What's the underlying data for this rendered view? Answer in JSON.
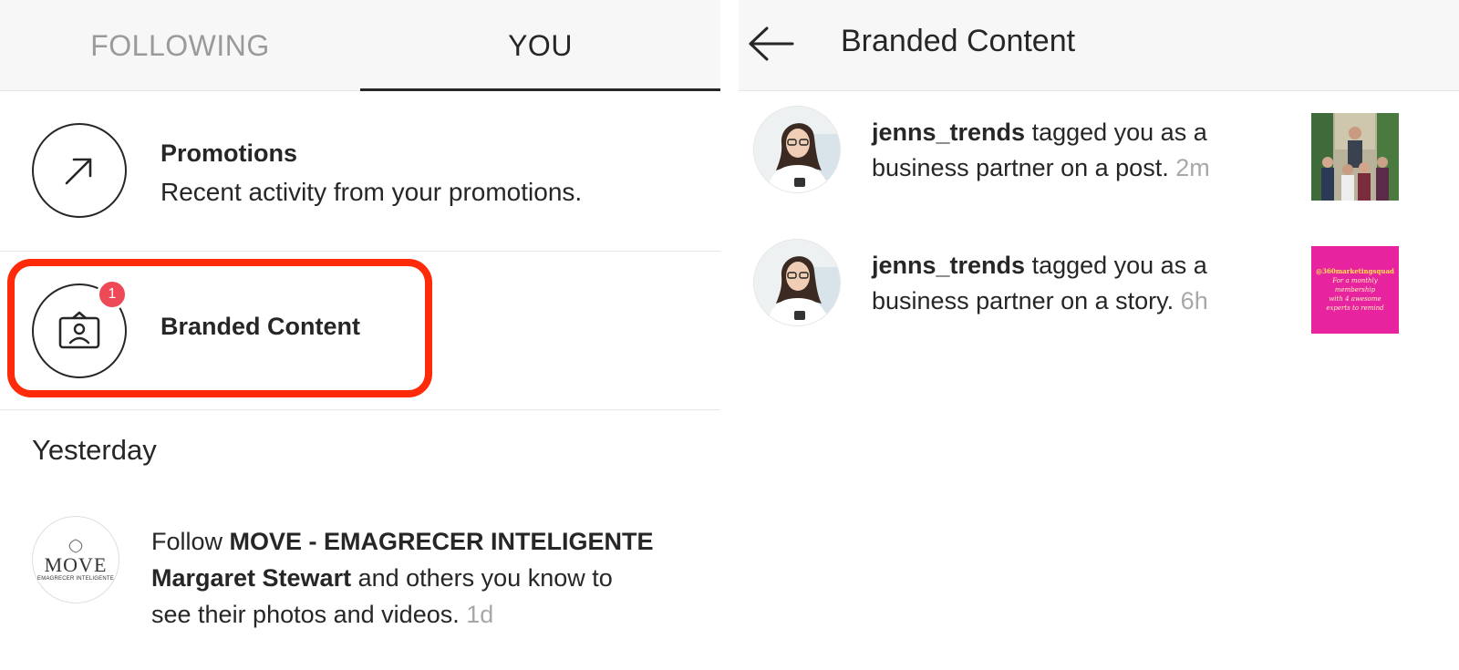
{
  "tabs": {
    "following_label": "FOLLOWING",
    "you_label": "YOU"
  },
  "promotions": {
    "title": "Promotions",
    "subtitle": "Recent activity from your promotions.",
    "icon": "arrow-up-right-icon"
  },
  "branded_content_row": {
    "title": "Branded Content",
    "badge_count": "1",
    "icon": "branded-content-icon"
  },
  "sections": {
    "yesterday_heading": "Yesterday"
  },
  "suggestion": {
    "avatar_word": "MOVE",
    "avatar_tagline": "EMAGRECER INTELIGENTE",
    "prefix": "Follow ",
    "account": "MOVE - EMAGRECER INTELIGENTE",
    "person": "Margaret Stewart",
    "rest_line2": " and others you know to",
    "line3": "see their photos and videos.",
    "time": " 1d"
  },
  "right_panel": {
    "title": "Branded Content",
    "back_icon": "back-arrow-icon",
    "notifications": [
      {
        "username": "jenns_trends",
        "line1_rest": " tagged you as a",
        "line2": "business partner on a post.",
        "time": " 2m"
      },
      {
        "username": "jenns_trends",
        "line1_rest": " tagged you as a",
        "line2": "business partner on a story.",
        "time": " 6h",
        "story_handle": "@360marketingsquad",
        "story_lines": [
          "For a monthly",
          "membership",
          "with 4 awesome",
          "experts to remind"
        ]
      }
    ]
  },
  "colors": {
    "highlight": "#ff2a0a",
    "badge": "#ed4956",
    "muted_text": "#a8a8a8",
    "story_bg": "#e7239f"
  }
}
